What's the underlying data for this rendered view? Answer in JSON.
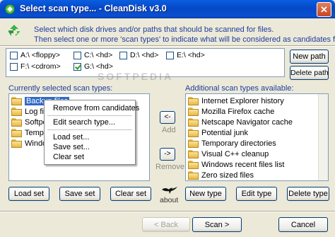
{
  "window": {
    "title": "Select scan type... - CleanDisk v3.0",
    "close_glyph": "✕"
  },
  "instructions": {
    "line1": "Select which disk drives and/or paths that should be scanned for files.",
    "line2": "Then select one or more 'scan types' to indicate what will be considered as candidates for cleaning."
  },
  "drives": [
    {
      "label": "A:\\ <floppy>",
      "checked": false
    },
    {
      "label": "C:\\ <hd>",
      "checked": false
    },
    {
      "label": "D:\\ <hd>",
      "checked": false
    },
    {
      "label": "E:\\ <hd>",
      "checked": false
    },
    {
      "label": "F:\\ <cdrom>",
      "checked": false
    },
    {
      "label": "G:\\ <hd>",
      "checked": true
    }
  ],
  "path_buttons": {
    "new_path": "New path",
    "delete_path": "Delete path"
  },
  "selected": {
    "label": "Currently selected scan types:",
    "items": [
      "Backup files",
      "Log file",
      "Softpe",
      "Tempor",
      "Windo"
    ]
  },
  "context_menu": {
    "items": [
      "Remove from candidates",
      "Edit search type...",
      "Load set...",
      "Save set...",
      "Clear set"
    ]
  },
  "move": {
    "add_glyph": "<-",
    "add_label": "Add",
    "remove_glyph": "->",
    "remove_label": "Remove"
  },
  "available": {
    "label": "Additional scan types available:",
    "items": [
      "Internet Explorer history",
      "Mozilla Firefox cache",
      "Netscape Navigator cache",
      "Potential junk",
      "Temporary directories",
      "Visual C++ cleanup",
      "Windows recent files list",
      "Zero sized files"
    ]
  },
  "set_buttons": {
    "load": "Load set",
    "save": "Save set",
    "clear": "Clear set"
  },
  "type_buttons": {
    "new": "New type",
    "edit": "Edit type",
    "delete": "Delete type"
  },
  "about_label": "about",
  "watermark": "SOFTPEDIA",
  "footer": {
    "back": "< Back",
    "scan": "Scan >",
    "cancel": "Cancel"
  },
  "colors": {
    "title_bar": "#0a56d8",
    "accent_text": "#1f3d9e",
    "selection": "#316ac5"
  }
}
